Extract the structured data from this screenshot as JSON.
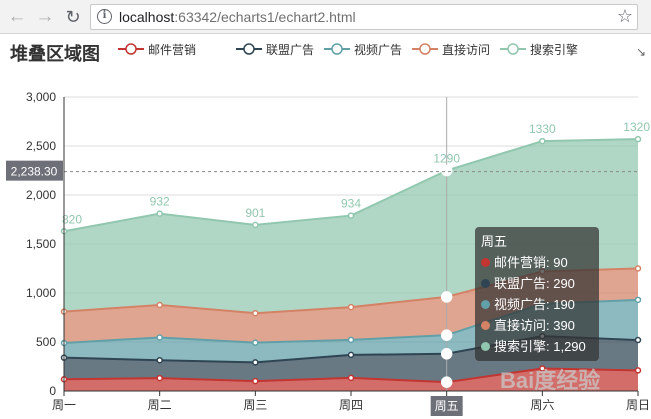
{
  "browser": {
    "url_host": "localhost",
    "url_rest": ":63342/echarts1/echart2.html",
    "back_icon": "arrow-left-icon",
    "forward_icon": "arrow-right-icon",
    "reload_icon": "reload-icon",
    "star_icon": "star-icon"
  },
  "watermark": "Bai度经验",
  "chart_data": {
    "type": "area",
    "stacked": true,
    "title": "堆叠区域图",
    "categories": [
      "周一",
      "周二",
      "周三",
      "周四",
      "周五",
      "周六",
      "周日"
    ],
    "series": [
      {
        "name": "邮件营销",
        "values": [
          120,
          132,
          101,
          134,
          90,
          230,
          210
        ],
        "color": "#c23531"
      },
      {
        "name": "联盟广告",
        "values": [
          220,
          182,
          191,
          234,
          290,
          330,
          310
        ],
        "color": "#2f4554"
      },
      {
        "name": "视频广告",
        "values": [
          150,
          232,
          201,
          154,
          190,
          330,
          410
        ],
        "color": "#61a0a8"
      },
      {
        "name": "直接访问",
        "values": [
          320,
          332,
          301,
          334,
          390,
          330,
          320
        ],
        "color": "#d48265"
      },
      {
        "name": "搜索引擎",
        "values": [
          820,
          932,
          901,
          934,
          1290,
          1330,
          1320
        ],
        "color": "#91c7ae"
      }
    ],
    "top_labels": [
      "820",
      "932",
      "901",
      "934",
      "1290",
      "1330",
      "1320"
    ],
    "yticks": [
      "0",
      "500",
      "1,000",
      "1,500",
      "2,000",
      "2,500",
      "3,000"
    ],
    "ylim": [
      0,
      3000
    ],
    "axis_pointer": {
      "category": "周五",
      "y_label": "2,238.30",
      "y_value": 2238.3
    },
    "tooltip": {
      "title": "周五",
      "rows": [
        {
          "name": "邮件营销",
          "value": "90"
        },
        {
          "name": "联盟广告",
          "value": "290"
        },
        {
          "name": "视频广告",
          "value": "190"
        },
        {
          "name": "直接访问",
          "value": "390"
        },
        {
          "name": "搜索引擎",
          "value": "1,290"
        }
      ]
    },
    "legend_position": "top"
  }
}
